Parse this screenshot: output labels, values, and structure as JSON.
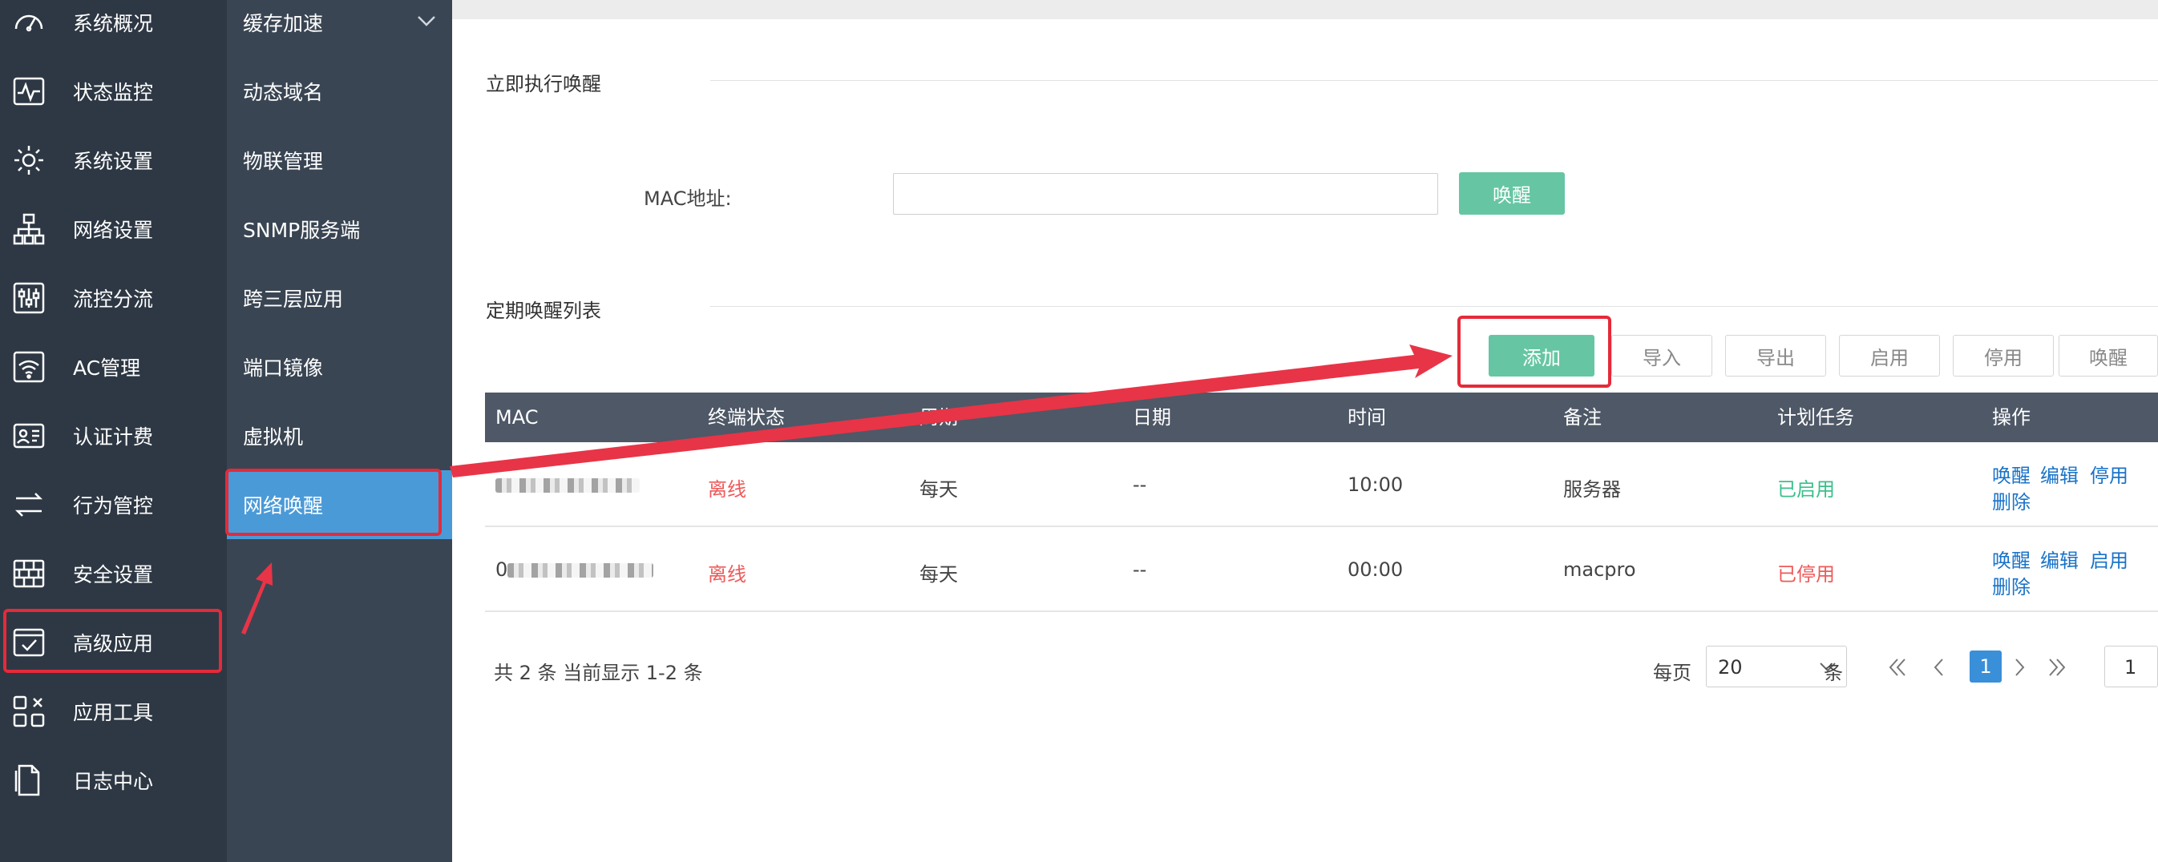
{
  "nav": {
    "items": [
      {
        "label": "系统概况",
        "icon": "speedometer-icon"
      },
      {
        "label": "状态监控",
        "icon": "pulse-monitor-icon"
      },
      {
        "label": "系统设置",
        "icon": "gear-icon"
      },
      {
        "label": "网络设置",
        "icon": "network-tree-icon"
      },
      {
        "label": "流控分流",
        "icon": "sliders-icon"
      },
      {
        "label": "AC管理",
        "icon": "wifi-icon"
      },
      {
        "label": "认证计费",
        "icon": "id-card-icon"
      },
      {
        "label": "行为管控",
        "icon": "arrows-swap-icon"
      },
      {
        "label": "安全设置",
        "icon": "firewall-icon"
      },
      {
        "label": "高级应用",
        "icon": "checkbox-window-icon"
      },
      {
        "label": "应用工具",
        "icon": "tools-grid-icon"
      },
      {
        "label": "日志中心",
        "icon": "document-icon"
      }
    ]
  },
  "submenu": {
    "items": [
      {
        "label": "缓存加速"
      },
      {
        "label": "动态域名"
      },
      {
        "label": "物联管理"
      },
      {
        "label": "SNMP服务端"
      },
      {
        "label": "跨三层应用"
      },
      {
        "label": "端口镜像"
      },
      {
        "label": "虚拟机"
      },
      {
        "label": "网络唤醒"
      }
    ]
  },
  "main": {
    "instant_title": "立即执行唤醒",
    "mac_label": "MAC地址:",
    "mac_value": "",
    "wake_button": "唤醒",
    "schedule_title": "定期唤醒列表",
    "toolbar": {
      "add": "添加",
      "import": "导入",
      "export": "导出",
      "enable": "启用",
      "disable": "停用",
      "wake": "唤醒"
    },
    "table": {
      "headers": [
        "MAC",
        "终端状态",
        "周期",
        "日期",
        "时间",
        "备注",
        "计划任务",
        "操作"
      ],
      "rows": [
        {
          "mac": "",
          "status": "离线",
          "cycle": "每天",
          "date": "--",
          "time": "10:00",
          "note": "服务器",
          "task": "已启用",
          "op_wake": "唤醒",
          "op_edit": "编辑",
          "op_toggle": "停用",
          "op_delete": "删除"
        },
        {
          "mac": "0",
          "status": "离线",
          "cycle": "每天",
          "date": "--",
          "time": "00:00",
          "note": "macpro",
          "task": "已停用",
          "op_wake": "唤醒",
          "op_edit": "编辑",
          "op_toggle": "启用",
          "op_delete": "删除"
        }
      ]
    },
    "pager": {
      "summary": "共 2 条 当前显示 1-2 条",
      "per_page_label": "每页",
      "per_page_value": "20",
      "unit": "条",
      "current_page": "1",
      "goto_value": "1"
    }
  },
  "colors": {
    "nav_bg": "#2e3844",
    "submenu_bg": "#3a4553",
    "active": "#4b9ad8",
    "green_button": "#66c6a3",
    "highlight": "#e52a3a"
  }
}
